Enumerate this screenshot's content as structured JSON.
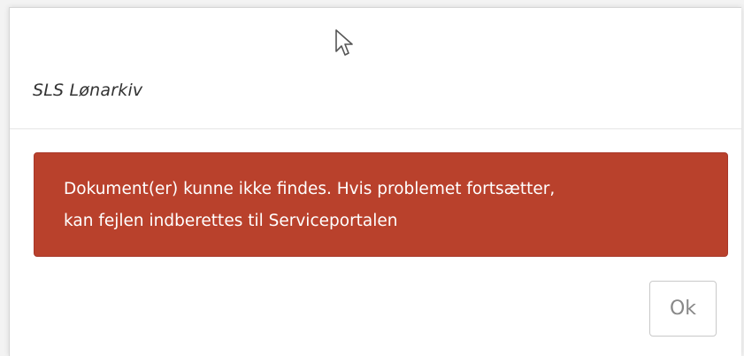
{
  "dialog": {
    "title": "SLS Lønarkiv",
    "alert": {
      "lines": [
        "Dokument(er) kunne ikke findes. Hvis problemet fortsætter,",
        "kan fejlen indberettes til Serviceportalen"
      ],
      "color": "#b9412c"
    },
    "ok_label": "Ok"
  },
  "cursor": {
    "icon": "mouse-pointer-icon"
  }
}
